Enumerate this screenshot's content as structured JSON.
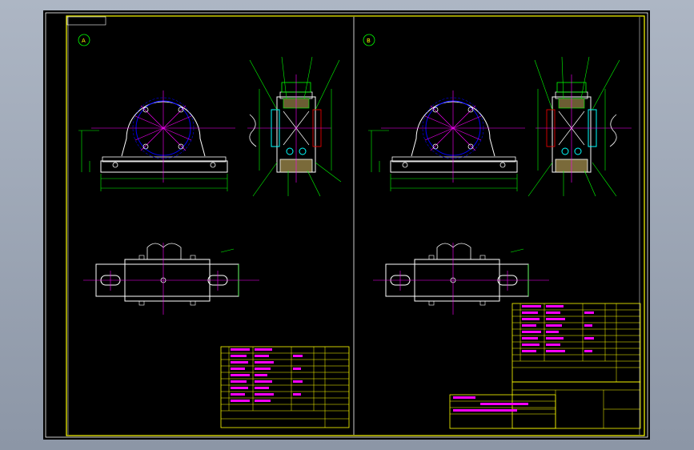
{
  "drawing": {
    "view_a_label": "A",
    "view_b_label": "B",
    "code_tag": "",
    "title_block_text": "",
    "note_heading": "",
    "note_text": "",
    "colors": {
      "background": "#000000",
      "frame": "#ffff00",
      "centerline": "#ff00ff",
      "geometry": "#ffffff",
      "dimension": "#00ff00",
      "bearing": "#00ffff",
      "hatch": "#00ff00",
      "table_line": "#ffff00",
      "table_text": "#ff00ff"
    }
  }
}
